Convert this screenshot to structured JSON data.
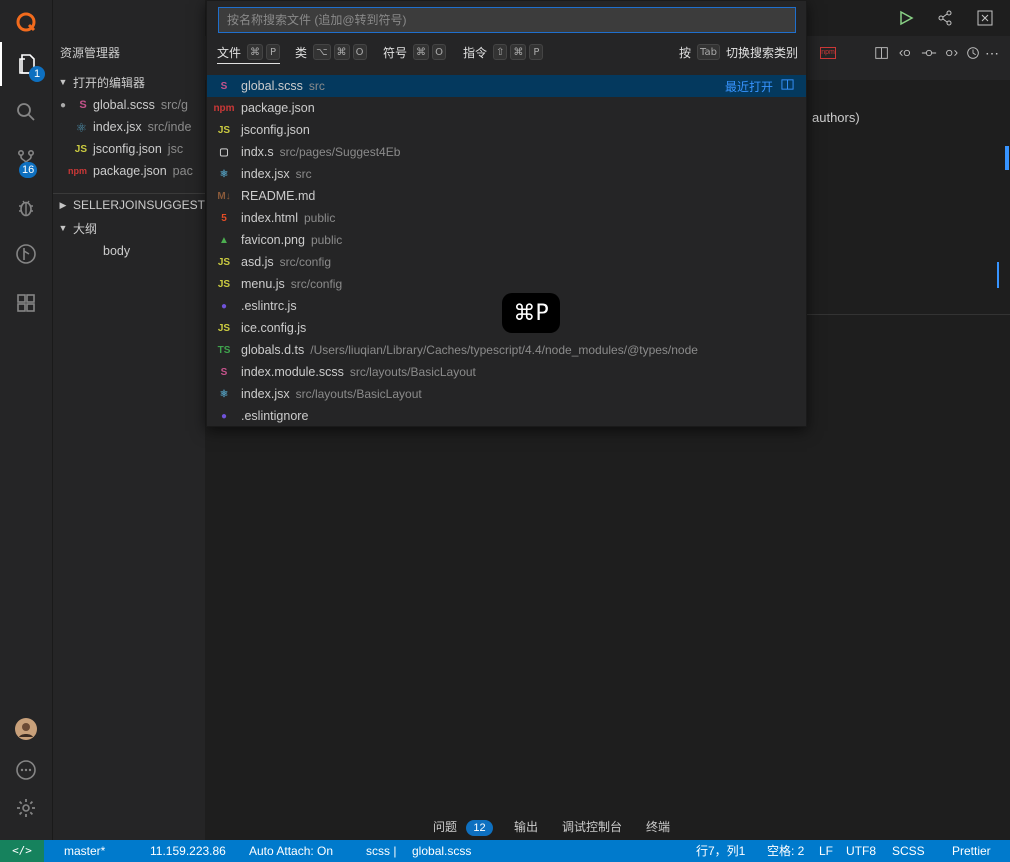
{
  "activity_bar": {
    "explorer_badge": "1",
    "scm_badge": "16"
  },
  "sidebar": {
    "title": "资源管理器",
    "open_editors_label": "打开的编辑器",
    "open_editors": [
      {
        "name": "global.scss",
        "desc": "src/g",
        "icon": "scss-icon",
        "modified": true
      },
      {
        "name": "index.jsx",
        "desc": "src/inde",
        "icon": "react-icon"
      },
      {
        "name": "jsconfig.json",
        "desc": "jsc",
        "icon": "js-icon"
      },
      {
        "name": "package.json",
        "desc": "pac",
        "icon": "npm-icon"
      }
    ],
    "project_label": "SELLERJOINSUGGEST",
    "outline_label": "大纲",
    "outline_item": "body"
  },
  "quick_open": {
    "placeholder": "按名称搜索文件 (追加@转到符号)",
    "filters": [
      {
        "label": "文件",
        "keys": [
          "⌘",
          "P"
        ]
      },
      {
        "label": "类",
        "keys": [
          "⌥",
          "⌘",
          "O"
        ]
      },
      {
        "label": "符号",
        "keys": [
          "⌘",
          "O"
        ]
      },
      {
        "label": "指令",
        "keys": [
          "⇧",
          "⌘",
          "P"
        ]
      }
    ],
    "tab_hint_prefix": "按",
    "tab_hint_key": "Tab",
    "tab_hint_suffix": "切换搜索类别",
    "recent_label": "最近打开",
    "results": [
      {
        "name": "global.scss",
        "desc": "src",
        "icon": "scss-icon",
        "glyph": "S",
        "color": "#c6538c"
      },
      {
        "name": "package.json",
        "desc": "",
        "icon": "npm-icon",
        "glyph": "npm",
        "color": "#cb3837"
      },
      {
        "name": "jsconfig.json",
        "desc": "",
        "icon": "js-icon",
        "glyph": "JS",
        "color": "#cbcb41"
      },
      {
        "name": "indx.s",
        "desc": "src/pages/Suggest4Eb",
        "icon": "file-icon",
        "glyph": "▢",
        "color": "#cccccc"
      },
      {
        "name": "index.jsx",
        "desc": "src",
        "icon": "react-icon",
        "glyph": "⚛",
        "color": "#519aba"
      },
      {
        "name": "README.md",
        "desc": "",
        "icon": "markdown-icon",
        "glyph": "M↓",
        "color": "#8a5a3a"
      },
      {
        "name": "index.html",
        "desc": "public",
        "icon": "html-icon",
        "glyph": "5",
        "color": "#e44d26"
      },
      {
        "name": "favicon.png",
        "desc": "public",
        "icon": "image-icon",
        "glyph": "▲",
        "color": "#4caf50"
      },
      {
        "name": "asd.js",
        "desc": "src/config",
        "icon": "js-icon",
        "glyph": "JS",
        "color": "#cbcb41"
      },
      {
        "name": "menu.js",
        "desc": "src/config",
        "icon": "js-icon",
        "glyph": "JS",
        "color": "#cbcb41"
      },
      {
        "name": ".eslintrc.js",
        "desc": "",
        "icon": "eslint-icon",
        "glyph": "●",
        "color": "#6f52d9"
      },
      {
        "name": "ice.config.js",
        "desc": "",
        "icon": "js-icon",
        "glyph": "JS",
        "color": "#cbcb41"
      },
      {
        "name": "globals.d.ts",
        "desc": "/Users/liuqian/Library/Caches/typescript/4.4/node_modules/@types/node",
        "icon": "ts-icon",
        "glyph": "TS",
        "color": "#3fa34d"
      },
      {
        "name": "index.module.scss",
        "desc": "src/layouts/BasicLayout",
        "icon": "scss-icon",
        "glyph": "S",
        "color": "#c6538c"
      },
      {
        "name": "index.jsx",
        "desc": "src/layouts/BasicLayout",
        "icon": "react-icon",
        "glyph": "⚛",
        "color": "#519aba"
      },
      {
        "name": ".eslintignore",
        "desc": "",
        "icon": "eslint-icon",
        "glyph": "●",
        "color": "#6f52d9"
      }
    ]
  },
  "shortcut_hint": "⌘P",
  "editor": {
    "peek_text": "authors)"
  },
  "panel": {
    "problems": "问题",
    "problems_count": "12",
    "output": "输出",
    "debug_console": "调试控制台",
    "terminal": "终端"
  },
  "status_bar": {
    "remote": "</>",
    "branch": "master*",
    "ip": "11.159.223.86",
    "auto_attach": "Auto Attach: On",
    "scss": "scss |",
    "file": "global.scss",
    "position": "行7，列1",
    "spaces": "空格: 2",
    "eol": "LF",
    "encoding": "UTF8",
    "language": "SCSS",
    "formatter": "Prettier"
  }
}
